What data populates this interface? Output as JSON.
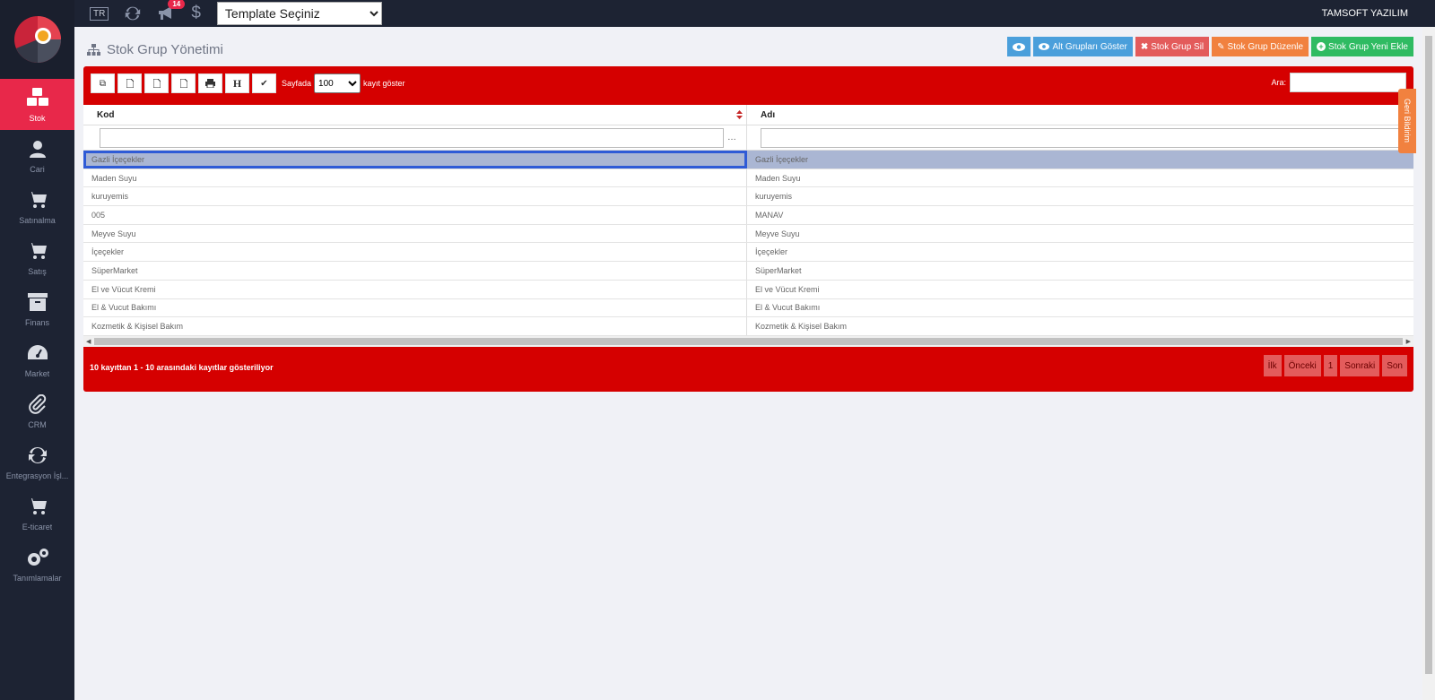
{
  "topbar": {
    "lang": "TR",
    "notification_count": "14",
    "template_select": {
      "selected": "Template Seçiniz"
    },
    "brand": "TAMSOFT YAZILIM"
  },
  "sidebar": {
    "items": [
      {
        "label": "Stok",
        "icon": "cubes-icon",
        "active": true
      },
      {
        "label": "Cari",
        "icon": "user-icon"
      },
      {
        "label": "Satınalma",
        "icon": "cart-plus-icon"
      },
      {
        "label": "Satış",
        "icon": "cart-arrow-icon"
      },
      {
        "label": "Finans",
        "icon": "archive-icon"
      },
      {
        "label": "Market",
        "icon": "dashboard-icon"
      },
      {
        "label": "CRM",
        "icon": "paperclip-icon"
      },
      {
        "label": "Entegrasyon İşl...",
        "icon": "refresh-icon"
      },
      {
        "label": "E-ticaret",
        "icon": "shopping-cart-icon"
      },
      {
        "label": "Tanımlamalar",
        "icon": "gears-icon"
      }
    ]
  },
  "page": {
    "title": "Stok Grup Yönetimi",
    "actions": {
      "show_sub_groups": "Alt Grupları Göster",
      "delete": "Stok Grup Sil",
      "edit": "Stok Grup Düzenle",
      "add_new": "Stok Grup Yeni Ekle"
    }
  },
  "table": {
    "toolbar": {
      "h_label": "H",
      "page_len_label": "Sayfada",
      "page_len_value": "100",
      "page_len_suffix": "kayıt göster",
      "search_label": "Ara:"
    },
    "columns": [
      "Kod",
      "Adı"
    ],
    "rows": [
      [
        "Gazli İçeçekler",
        "Gazli İçeçekler"
      ],
      [
        "Maden Suyu",
        "Maden Suyu"
      ],
      [
        "kuruyemis",
        "kuruyemis"
      ],
      [
        "005",
        "MANAV"
      ],
      [
        "Meyve Suyu",
        "Meyve Suyu"
      ],
      [
        "İçeçekler",
        "İçeçekler"
      ],
      [
        "SüperMarket",
        "SüperMarket"
      ],
      [
        "El ve Vücut Kremi",
        "El ve Vücut Kremi"
      ],
      [
        "El & Vucut Bakımı",
        "El & Vucut Bakımı"
      ],
      [
        "Kozmetik & Kişisel Bakım",
        "Kozmetik & Kişisel Bakım"
      ]
    ],
    "selected_row": 0,
    "info": "10 kayıttan 1 - 10 arasındaki kayıtlar gösteriliyor",
    "pager": {
      "first": "İlk",
      "prev": "Önceki",
      "page": "1",
      "next": "Sonraki",
      "last": "Son"
    }
  },
  "feedback_label": "Geri Bildirim",
  "colors": {
    "sidebar_bg": "#1d2333",
    "active": "#e8284a",
    "panel_red": "#d50000",
    "btn_blue": "#4a9fdb",
    "btn_red": "#e35b5b",
    "btn_orange": "#f1813f",
    "btn_green": "#2fbb62"
  }
}
